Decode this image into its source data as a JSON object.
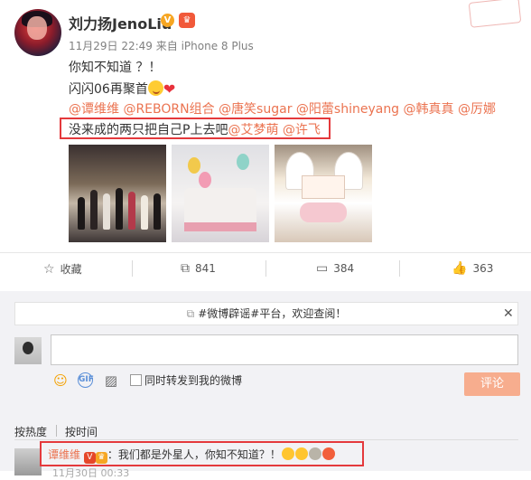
{
  "post": {
    "user_name": "刘力扬JenoLiu",
    "meta": "11月29日 22:49 来自 iPhone 8 Plus",
    "line1": "你知不知道 ？！",
    "line2": "闪闪06再聚首",
    "mentions_line": [
      "@谭维维",
      "@REBORN组合",
      "@唐笑sugar",
      "@阳蕾shineyang",
      "@韩真真",
      "@厉娜"
    ],
    "line4_text": "没来成的两只把自己P上去吧",
    "line4_mentions": [
      "@艾梦萌",
      "@许飞"
    ]
  },
  "photos": [
    "group-photo",
    "cake-photo",
    "swan-cake-photo"
  ],
  "actions": {
    "favorite_label": "收藏",
    "repost_count": "841",
    "comment_count": "384",
    "like_count": "363"
  },
  "comment_box": {
    "notice": "#微博辟谣#平台，欢迎查阅！",
    "repost_checkbox_label": "同时转发到我的微博",
    "submit_label": "评论"
  },
  "sort": {
    "hot_label": "按热度",
    "time_label": "按时间"
  },
  "top_comment": {
    "user": "谭维维",
    "text": "：我们都是外星人，你知不知道？！",
    "meta": "11月30日 00:33"
  },
  "icons": {
    "favorite": "star-icon",
    "repost": "repost-icon",
    "comment": "comment-icon",
    "like": "thumbs-up-icon"
  },
  "colors": {
    "mention": "#eb7350",
    "highlight": "#e4393c",
    "submit_button": "#f7ad8e"
  }
}
